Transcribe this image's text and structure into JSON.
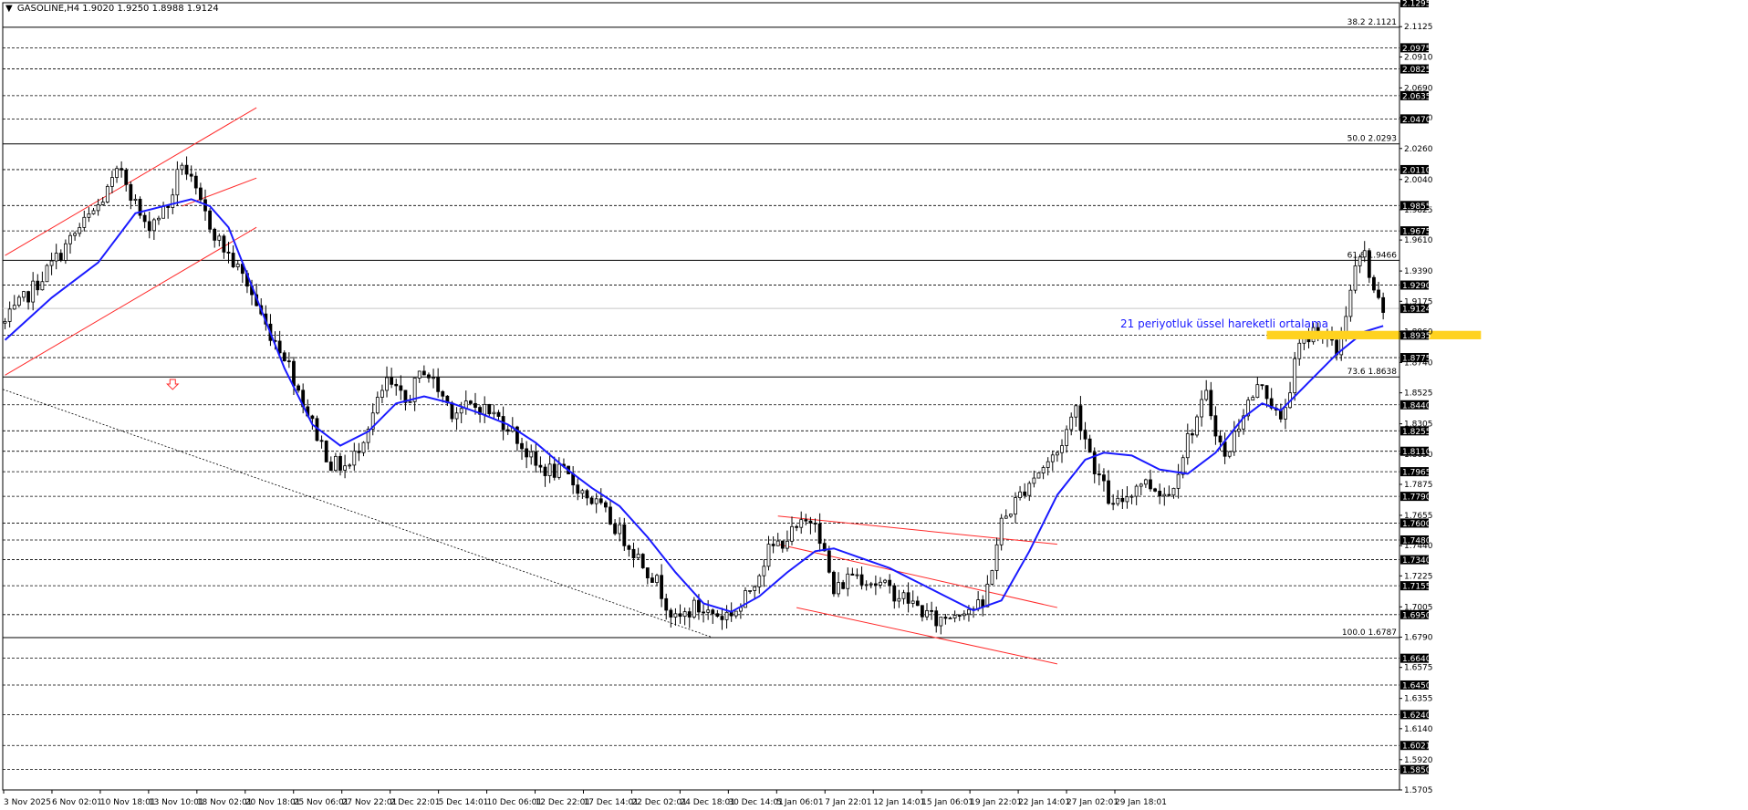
{
  "chart_data": {
    "type": "candlestick",
    "title": "GASOLINE,H4  1.9020 1.9250 1.8988 1.9124",
    "symbol_marker": "▼",
    "ylim": [
      1.5705,
      2.1295
    ],
    "grid": false,
    "y_labels_plain": [
      "2.1125",
      "2.0910",
      "2.0690",
      "2.0480",
      "2.0260",
      "2.0040",
      "1.9825",
      "1.9610",
      "1.9390",
      "1.9175",
      "1.8960",
      "1.8740",
      "1.8525",
      "1.8305",
      "1.8090",
      "1.7875",
      "1.7655",
      "1.7440",
      "1.7225",
      "1.7005",
      "1.6790",
      "1.6575",
      "1.6355",
      "1.6140",
      "1.5920",
      "1.5705"
    ],
    "y_labels_boxed": [
      "2.1295",
      "2.0975",
      "2.0825",
      "2.0635",
      "2.0470",
      "2.0110",
      "1.9855",
      "1.9675",
      "1.9290",
      "1.9124",
      "1.8935",
      "1.8775",
      "1.8440",
      "1.8255",
      "1.8110",
      "1.7965",
      "1.7790",
      "1.7600",
      "1.7480",
      "1.7340",
      "1.7155",
      "1.6950",
      "1.6640",
      "1.6450",
      "1.6240",
      "1.6021",
      "1.5850"
    ],
    "dashed_levels": [
      2.0975,
      2.0825,
      2.0635,
      2.047,
      2.011,
      1.9855,
      1.9675,
      1.929,
      1.8935,
      1.8775,
      1.844,
      1.8255,
      1.811,
      1.7965,
      1.779,
      1.76,
      1.748,
      1.734,
      1.7155,
      1.695,
      1.664,
      1.645,
      1.624,
      1.6021,
      1.585
    ],
    "fib_levels": [
      {
        "label": "38.2  2.1121",
        "value": 2.1121
      },
      {
        "label": "50.0  2.0293",
        "value": 2.0293
      },
      {
        "label": "61.8  1.9466",
        "value": 1.9466
      },
      {
        "label": "73.6  1.8638",
        "value": 1.8638
      },
      {
        "label": "100.0  1.6787",
        "value": 1.6787
      }
    ],
    "current_price": 1.9124,
    "x_labels": [
      "3 Nov 2025",
      "6 Nov 02:01",
      "10 Nov 18:01",
      "13 Nov 10:01",
      "18 Nov 02:01",
      "20 Nov 18:01",
      "25 Nov 06:01",
      "27 Nov 22:01",
      "2 Dec 22:01",
      "5 Dec 14:01",
      "10 Dec 06:01",
      "12 Dec 22:01",
      "17 Dec 14:01",
      "22 Dec 02:01",
      "24 Dec 18:01",
      "30 Dec 14:01",
      "5 Jan 06:01",
      "7 Jan 22:01",
      "12 Jan 14:01",
      "15 Jan 06:01",
      "19 Jan 22:01",
      "22 Jan 14:01",
      "27 Jan 02:01",
      "29 Jan 18:01"
    ],
    "price_path": [
      [
        0,
        1.902
      ],
      [
        8,
        1.935
      ],
      [
        15,
        1.965
      ],
      [
        20,
        1.985
      ],
      [
        25,
        2.012
      ],
      [
        30,
        1.97
      ],
      [
        35,
        1.985
      ],
      [
        38,
        2.017
      ],
      [
        42,
        1.985
      ],
      [
        46,
        1.96
      ],
      [
        52,
        1.93
      ],
      [
        56,
        1.9
      ],
      [
        60,
        1.88
      ],
      [
        66,
        1.83
      ],
      [
        70,
        1.802
      ],
      [
        74,
        1.8
      ],
      [
        78,
        1.83
      ],
      [
        82,
        1.86
      ],
      [
        86,
        1.845
      ],
      [
        90,
        1.87
      ],
      [
        96,
        1.84
      ],
      [
        102,
        1.843
      ],
      [
        108,
        1.83
      ],
      [
        114,
        1.8
      ],
      [
        120,
        1.795
      ],
      [
        128,
        1.77
      ],
      [
        134,
        1.745
      ],
      [
        140,
        1.718
      ],
      [
        144,
        1.69
      ],
      [
        148,
        1.7
      ],
      [
        154,
        1.694
      ],
      [
        158,
        1.7
      ],
      [
        164,
        1.74
      ],
      [
        170,
        1.755
      ],
      [
        174,
        1.765
      ],
      [
        178,
        1.71
      ],
      [
        182,
        1.725
      ],
      [
        188,
        1.716
      ],
      [
        194,
        1.705
      ],
      [
        200,
        1.69
      ],
      [
        206,
        1.7
      ],
      [
        210,
        1.7
      ],
      [
        214,
        1.76
      ],
      [
        220,
        1.79
      ],
      [
        226,
        1.81
      ],
      [
        230,
        1.842
      ],
      [
        234,
        1.8
      ],
      [
        238,
        1.77
      ],
      [
        244,
        1.79
      ],
      [
        250,
        1.78
      ],
      [
        254,
        1.82
      ],
      [
        258,
        1.85
      ],
      [
        262,
        1.805
      ],
      [
        266,
        1.84
      ],
      [
        270,
        1.86
      ],
      [
        274,
        1.83
      ],
      [
        278,
        1.885
      ],
      [
        282,
        1.9
      ],
      [
        286,
        1.88
      ],
      [
        290,
        1.94
      ],
      [
        292,
        1.951
      ],
      [
        294,
        1.92
      ],
      [
        296,
        1.912
      ]
    ],
    "ema_path": [
      [
        0,
        1.89
      ],
      [
        10,
        1.92
      ],
      [
        20,
        1.945
      ],
      [
        28,
        1.98
      ],
      [
        34,
        1.985
      ],
      [
        40,
        1.99
      ],
      [
        44,
        1.985
      ],
      [
        48,
        1.97
      ],
      [
        54,
        1.92
      ],
      [
        60,
        1.87
      ],
      [
        66,
        1.83
      ],
      [
        72,
        1.815
      ],
      [
        78,
        1.825
      ],
      [
        84,
        1.845
      ],
      [
        90,
        1.85
      ],
      [
        96,
        1.845
      ],
      [
        102,
        1.838
      ],
      [
        108,
        1.83
      ],
      [
        114,
        1.817
      ],
      [
        120,
        1.8
      ],
      [
        126,
        1.785
      ],
      [
        132,
        1.772
      ],
      [
        138,
        1.75
      ],
      [
        144,
        1.725
      ],
      [
        150,
        1.703
      ],
      [
        156,
        1.697
      ],
      [
        162,
        1.708
      ],
      [
        168,
        1.725
      ],
      [
        174,
        1.74
      ],
      [
        178,
        1.742
      ],
      [
        184,
        1.735
      ],
      [
        190,
        1.728
      ],
      [
        196,
        1.718
      ],
      [
        202,
        1.708
      ],
      [
        208,
        1.698
      ],
      [
        214,
        1.705
      ],
      [
        220,
        1.74
      ],
      [
        226,
        1.78
      ],
      [
        232,
        1.805
      ],
      [
        236,
        1.81
      ],
      [
        242,
        1.808
      ],
      [
        248,
        1.798
      ],
      [
        254,
        1.795
      ],
      [
        260,
        1.81
      ],
      [
        266,
        1.835
      ],
      [
        270,
        1.845
      ],
      [
        274,
        1.84
      ],
      [
        280,
        1.86
      ],
      [
        286,
        1.88
      ],
      [
        292,
        1.896
      ],
      [
        296,
        1.9
      ]
    ],
    "support_zone": {
      "low": 1.8905,
      "high": 1.8965,
      "x_start": 271,
      "x_end": 317
    },
    "annotation": "21 periyotluk üssel hareketli ortalama",
    "colors": {
      "candle": "#000000",
      "ema": "#1a1aff",
      "channel": "#ff2a2a",
      "zone": "#ffd21f",
      "down_arrow": "#ff2a2a",
      "boxed_bg": "#000000"
    }
  }
}
